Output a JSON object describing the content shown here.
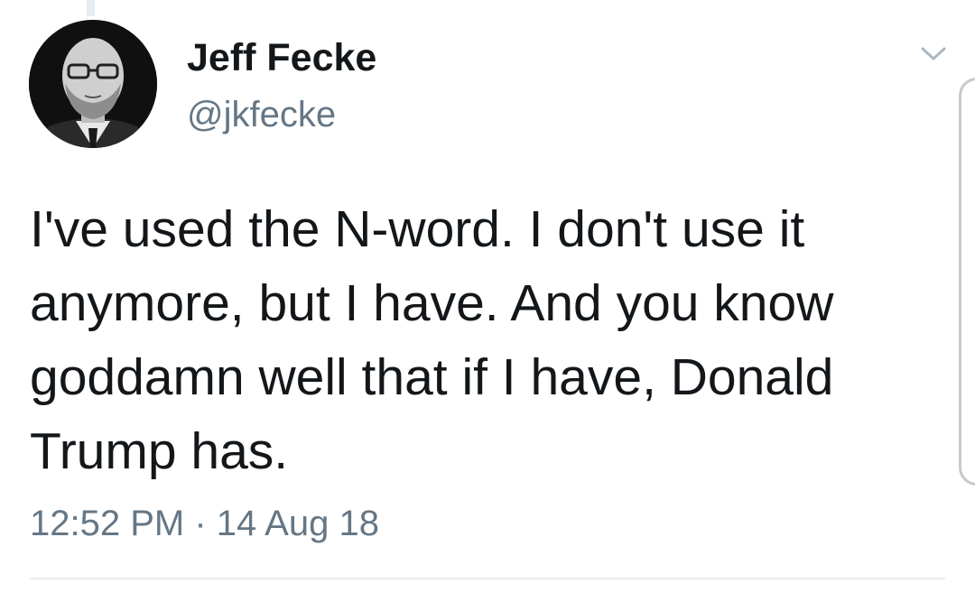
{
  "tweet": {
    "author": {
      "display_name": "Jeff Fecke",
      "handle": "@jkfecke"
    },
    "text": "I've used the N-word. I don't use it anymore, but I have. And you know goddamn well that if I have, Donald Trump has.",
    "timestamp": "12:52 PM · 14 Aug 18"
  },
  "icons": {
    "menu": "chevron-down-icon"
  },
  "colors": {
    "text_primary": "#14171a",
    "text_secondary": "#657786",
    "divider": "#e6ecf0"
  }
}
